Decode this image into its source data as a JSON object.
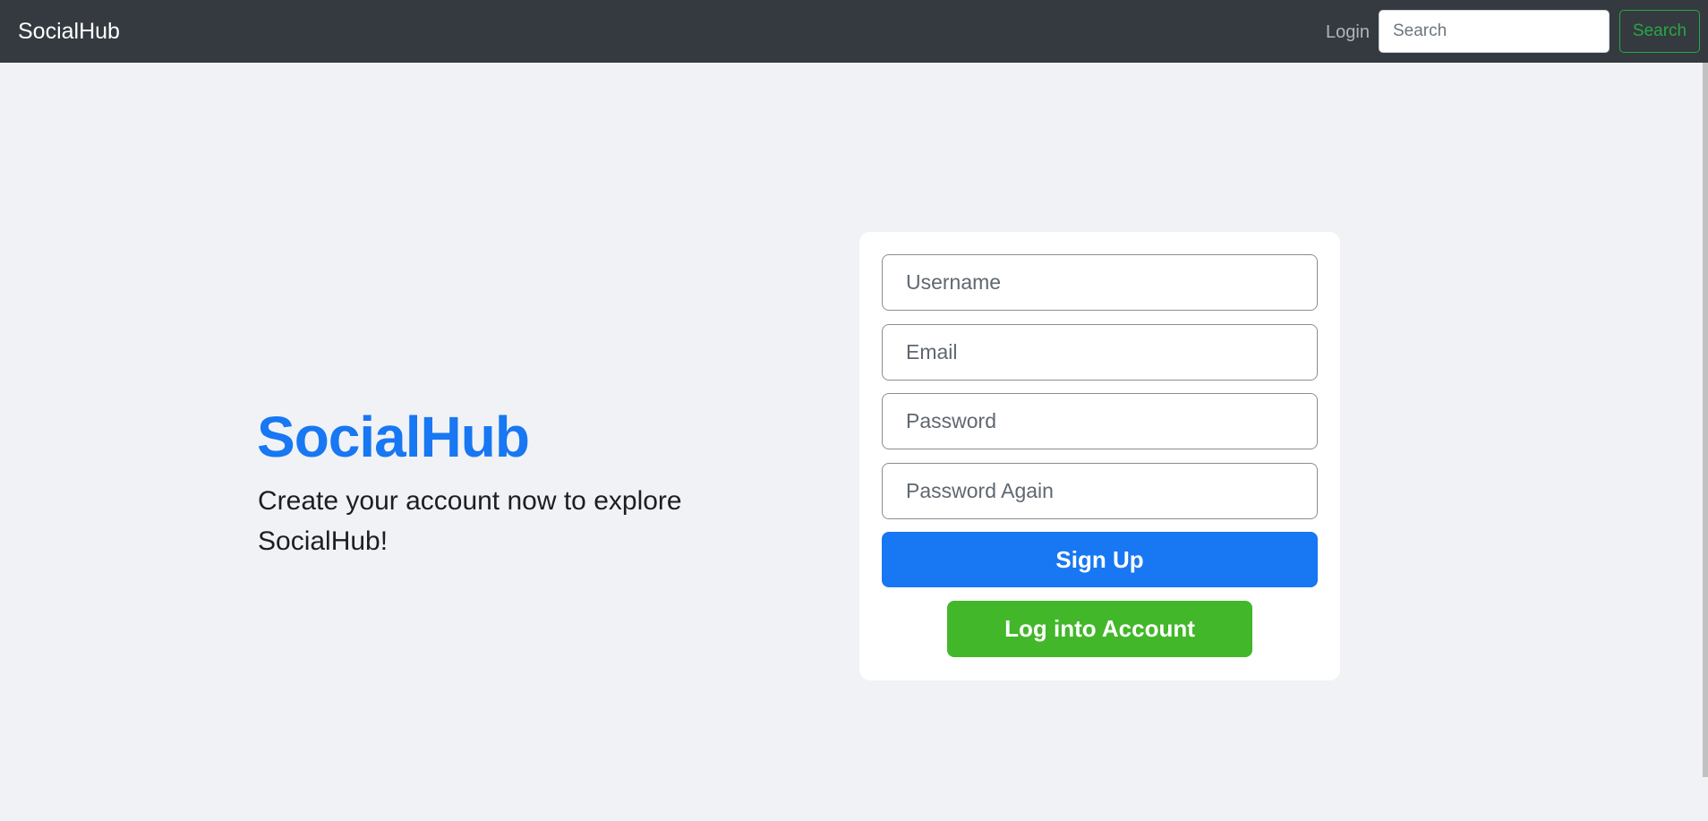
{
  "navbar": {
    "brand": "SocialHub",
    "login_link": "Login",
    "search_placeholder": "Search",
    "search_button": "Search"
  },
  "hero": {
    "title": "SocialHub",
    "subtitle": "Create your account now to explore SocialHub!"
  },
  "signup_form": {
    "username_placeholder": "Username",
    "email_placeholder": "Email",
    "password_placeholder": "Password",
    "password_again_placeholder": "Password Again",
    "signup_button": "Sign Up",
    "login_button": "Log into Account"
  },
  "colors": {
    "navbar_bg": "#343a40",
    "page_bg": "#f0f2f5",
    "brand_blue": "#1877f2",
    "login_green": "#42b72a",
    "search_outline_green": "#28a745"
  }
}
